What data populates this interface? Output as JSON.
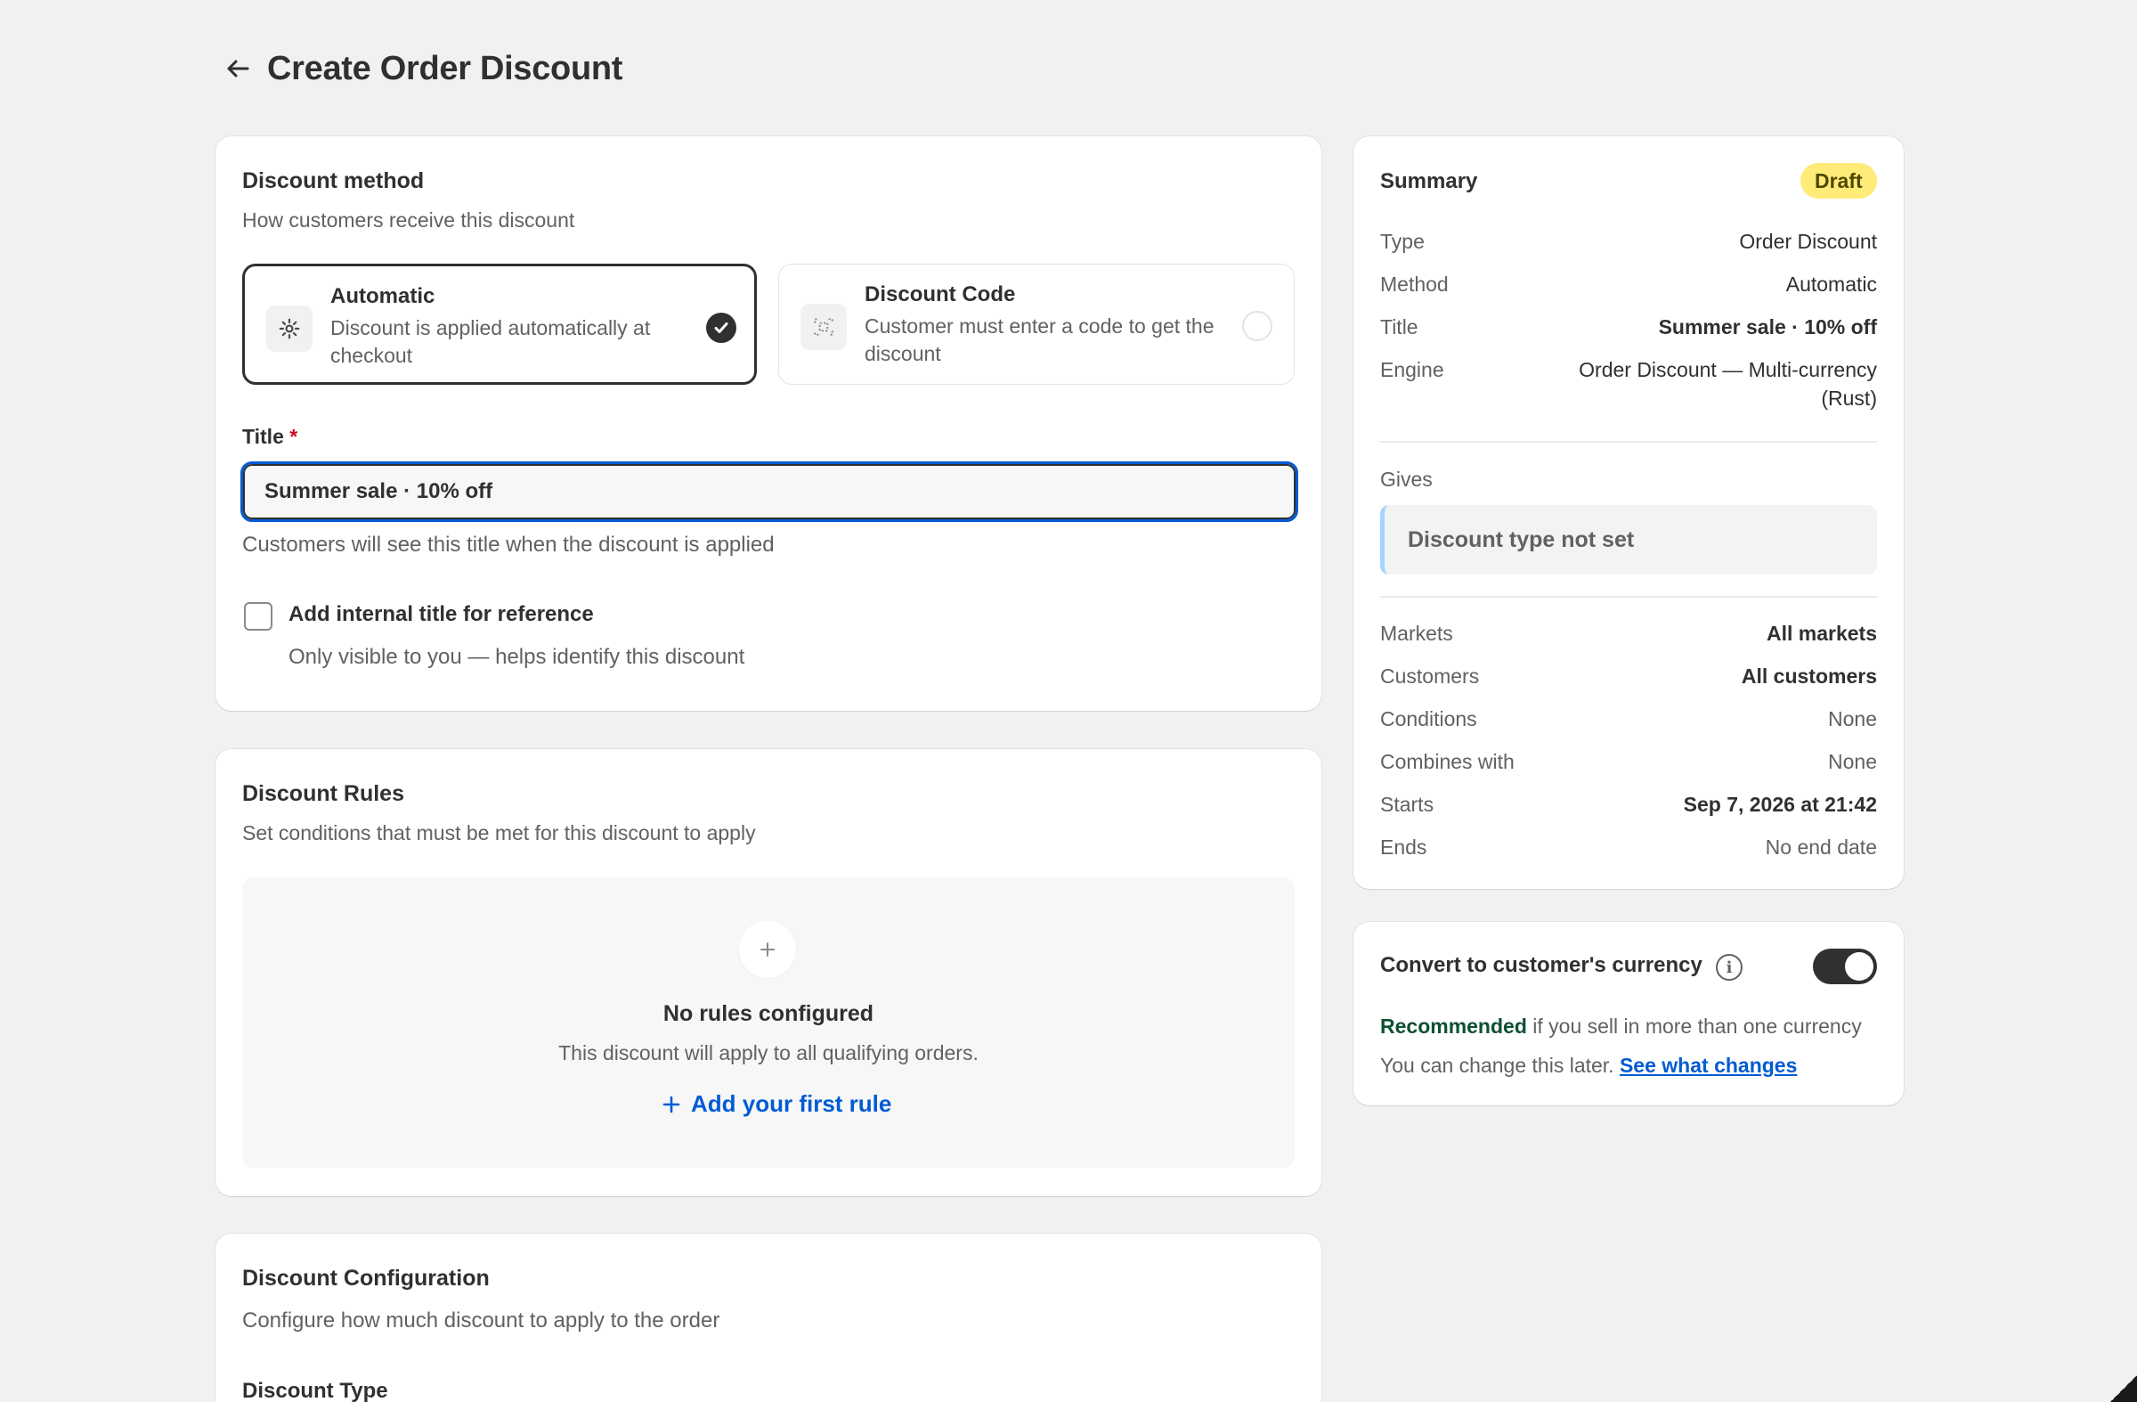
{
  "header": {
    "title": "Create Order Discount"
  },
  "method": {
    "title": "Discount method",
    "subtitle": "How customers receive this discount",
    "options": [
      {
        "title": "Automatic",
        "desc": "Discount is applied automatically at checkout",
        "selected": true
      },
      {
        "title": "Discount Code",
        "desc": "Customer must enter a code to get the discount",
        "selected": false
      }
    ]
  },
  "title_field": {
    "label": "Title",
    "required_mark": "*",
    "value": "Summer sale · 10% off",
    "help": "Customers will see this title when the discount is applied"
  },
  "internal_title": {
    "label": "Add internal title for reference",
    "help": "Only visible to you — helps identify this discount",
    "checked": false
  },
  "rules": {
    "title": "Discount Rules",
    "subtitle": "Set conditions that must be met for this discount to apply",
    "empty_title": "No rules configured",
    "empty_desc": "This discount will apply to all qualifying orders.",
    "add_label": "Add your first rule"
  },
  "config": {
    "title": "Discount Configuration",
    "subtitle": "Configure how much discount to apply to the order",
    "type_label": "Discount Type"
  },
  "summary": {
    "title": "Summary",
    "badge": "Draft",
    "type_label": "Type",
    "type_value": "Order Discount",
    "method_label": "Method",
    "method_value": "Automatic",
    "title_label": "Title",
    "title_value": "Summer sale · 10% off",
    "engine_label": "Engine",
    "engine_value_1": "Order Discount — Multi-currency",
    "engine_value_2": "(Rust)",
    "gives_label": "Gives",
    "gives_value": "Discount type not set",
    "markets_label": "Markets",
    "markets_value": "All markets",
    "customers_label": "Customers",
    "customers_value": "All customers",
    "conditions_label": "Conditions",
    "conditions_value": "None",
    "combines_label": "Combines with",
    "combines_value": "None",
    "starts_label": "Starts",
    "starts_value": "Sep 7, 2026 at 21:42",
    "ends_label": "Ends",
    "ends_value": "No end date"
  },
  "currency": {
    "title": "Convert to customer's currency",
    "enabled": true,
    "recommended": "Recommended",
    "rec_rest": " if you sell in more than one currency",
    "change_text": "You can change this later.",
    "link": "See what changes"
  },
  "colors": {
    "accent": "#005bd3",
    "badge": "#ffeb78",
    "dark": "#303030",
    "recommended": "#0c5132"
  },
  "icons": [
    "back-arrow-icon",
    "gear-icon",
    "code-scan-icon",
    "check-icon",
    "plus-icon",
    "info-icon"
  ]
}
